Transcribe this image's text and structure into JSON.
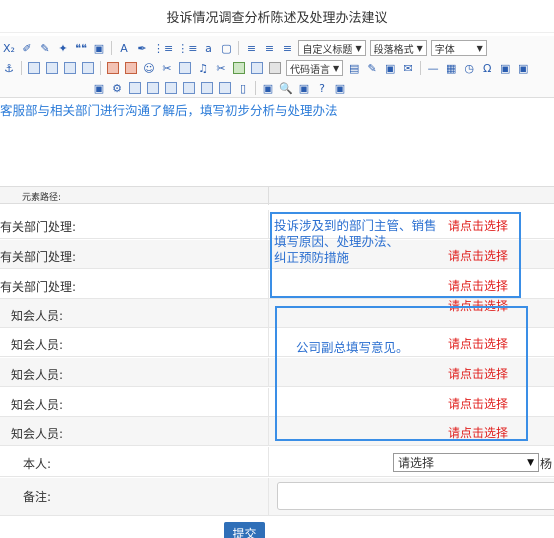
{
  "page": {
    "title": "投诉情况调查分析陈述及处理办法建议"
  },
  "toolbar": {
    "row1": [
      "X₂",
      "✐",
      "✎",
      "✦",
      "❝❝",
      "▣",
      "A",
      "✒",
      "⋮≡",
      "⋮≡",
      "a",
      "▢",
      "≡",
      "≡",
      "≡"
    ],
    "row2": [
      "⚓",
      "▣",
      "▣",
      "▣",
      "▣",
      "▣",
      "▣",
      "☺",
      "✂",
      "▣",
      "♫",
      "✂",
      "▣",
      "▣",
      "▣"
    ],
    "row2_tail": [
      "▤",
      "✎",
      "▣",
      "✉",
      "—",
      "▦",
      "◷",
      "Ω",
      "▣",
      "▣"
    ],
    "row3": [
      "▣",
      "⚙",
      "▣",
      "▣",
      "▣",
      "▣",
      "▣",
      "▣",
      "▯",
      "▣",
      "🔍",
      "▣",
      "?",
      "▣"
    ],
    "custom_title_combo": "自定义标题",
    "paragraph_combo": "段落格式",
    "font_combo": "字体",
    "code_lang_combo": "代码语言"
  },
  "editor": {
    "content": "客服部与相关部门进行沟通了解后，填写初步分析与处理办法"
  },
  "path_bar": {
    "label": "元素路径:"
  },
  "rows": [
    {
      "label": "有关部门处理:",
      "link": "请点击选择"
    },
    {
      "label": "有关部门处理:",
      "link": "请点击选择"
    },
    {
      "label": "有关部门处理:",
      "link": "请点击选择"
    },
    {
      "label": "知会人员:",
      "link": "请点击选择"
    },
    {
      "label": "知会人员:",
      "link": "请点击选择"
    },
    {
      "label": "知会人员:",
      "link": "请点击选择"
    },
    {
      "label": "知会人员:",
      "link": "请点击选择"
    },
    {
      "label": "知会人员:",
      "link": "请点击选择"
    }
  ],
  "annotations": {
    "dept_line1": "投诉涉及到的部门主管、销售",
    "dept_line2": "填写原因、处理办法、",
    "dept_line3": "纠正预防措施",
    "notify": "公司副总填写意见。"
  },
  "self": {
    "label": "本人:",
    "select_value": "请选择",
    "after_text": "杨"
  },
  "remark": {
    "label": "备注:",
    "value": ""
  },
  "submit": {
    "label": "提交"
  },
  "colors": {
    "link_red": "#e0201e",
    "annot_blue": "#3a8ee6",
    "editor_text": "#2b7bd8",
    "submit_bg": "#2f6fb8"
  }
}
